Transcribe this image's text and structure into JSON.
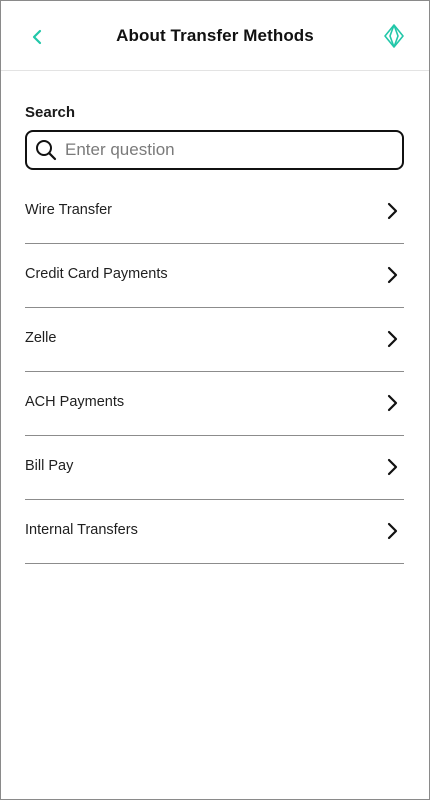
{
  "header": {
    "title": "About Transfer Methods",
    "back_icon": "chevron-left-icon",
    "logo_icon": "brand-logo-icon",
    "accent_color": "#22c7a9"
  },
  "search": {
    "label": "Search",
    "placeholder": "Enter question",
    "value": ""
  },
  "topics": [
    {
      "label": "Wire Transfer"
    },
    {
      "label": "Credit Card Payments"
    },
    {
      "label": "Zelle"
    },
    {
      "label": "ACH Payments"
    },
    {
      "label": "Bill Pay"
    },
    {
      "label": "Internal Transfers"
    }
  ]
}
